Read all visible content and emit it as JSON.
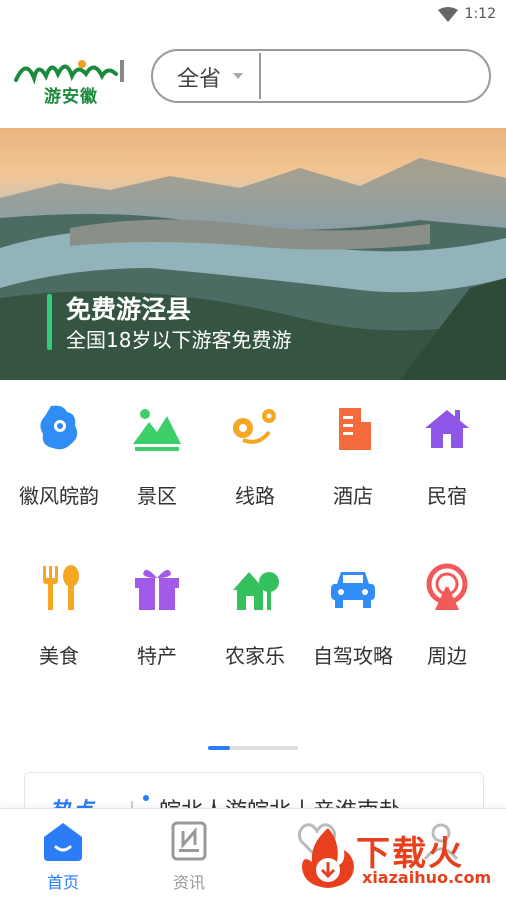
{
  "status": {
    "time": "1:12"
  },
  "header": {
    "logo_text": "游安徽",
    "province": "全省",
    "search_placeholder": ""
  },
  "banner": {
    "title": "免费游泾县",
    "subtitle": "全国18岁以下游客免费游"
  },
  "categories": [
    {
      "label": "徽风皖韵",
      "icon": "anhui-map-icon"
    },
    {
      "label": "景区",
      "icon": "mountain-icon"
    },
    {
      "label": "线路",
      "icon": "route-icon"
    },
    {
      "label": "酒店",
      "icon": "hotel-icon"
    },
    {
      "label": "民宿",
      "icon": "house-icon"
    },
    {
      "label": "美食",
      "icon": "food-icon"
    },
    {
      "label": "特产",
      "icon": "gift-icon"
    },
    {
      "label": "农家乐",
      "icon": "farmhouse-icon"
    },
    {
      "label": "自驾攻略",
      "icon": "car-icon"
    },
    {
      "label": "周边",
      "icon": "ferris-wheel-icon"
    }
  ],
  "news": {
    "tag": "热点",
    "headline": "皖北人游皖北丨亲淮南赴"
  },
  "tabbar": {
    "items": [
      {
        "label": "首页",
        "active": true
      },
      {
        "label": "资讯",
        "active": false
      }
    ]
  },
  "watermark": {
    "brand": "下载火",
    "url": "xiazaihuo.com"
  },
  "colors": {
    "accent": "#2b7cf6",
    "green": "#2bd07a",
    "watermark": "#e8401c"
  }
}
